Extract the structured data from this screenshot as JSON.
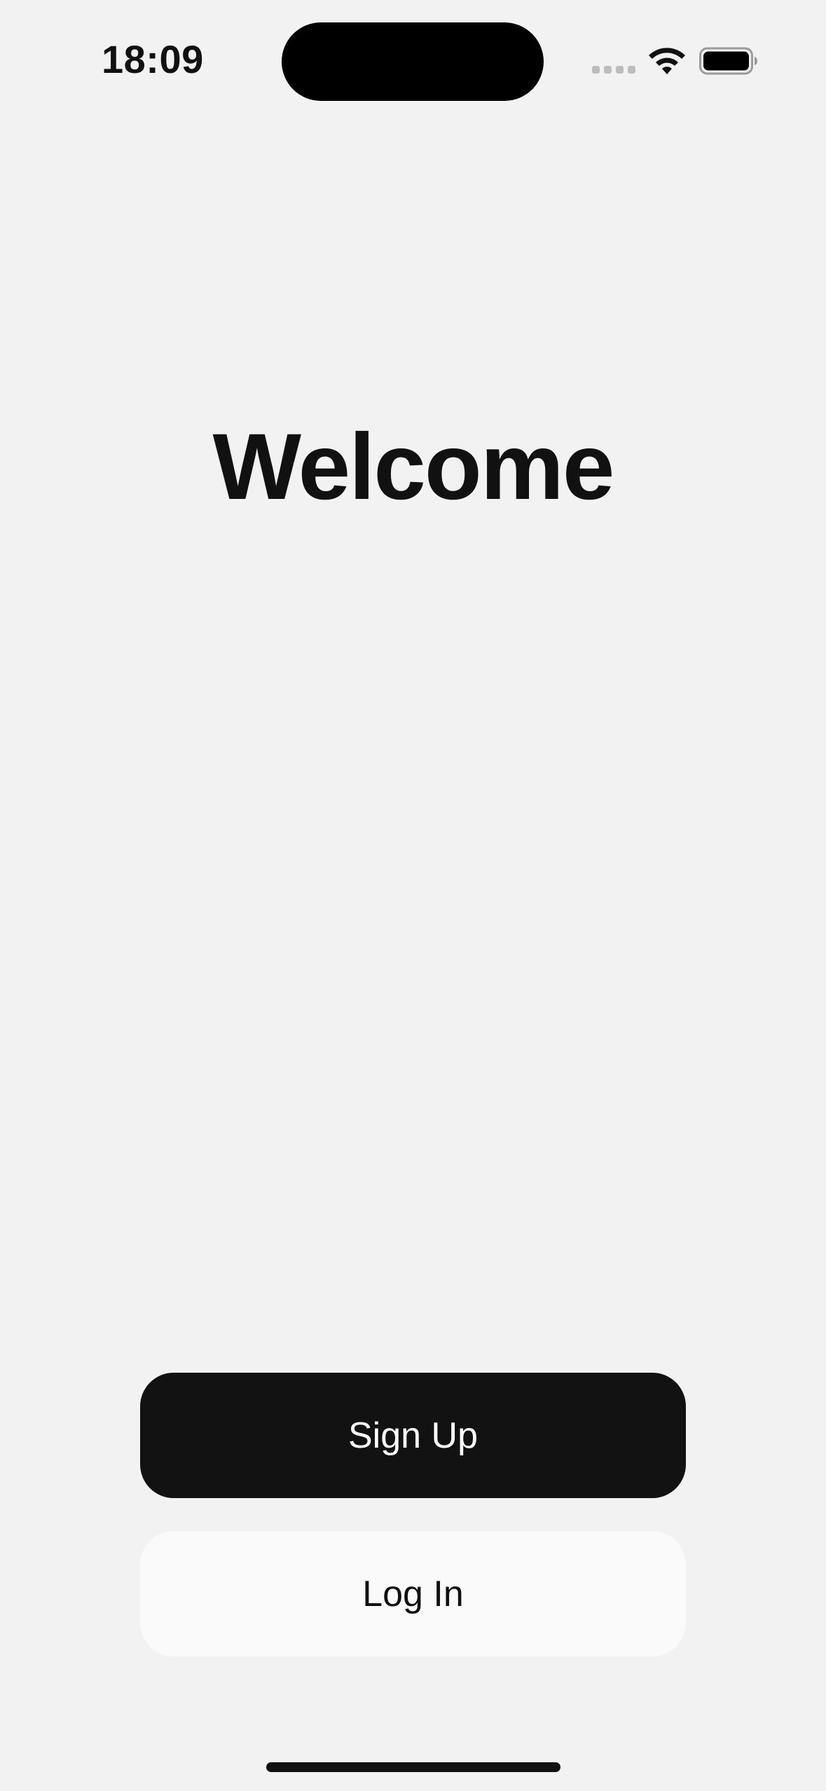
{
  "status_bar": {
    "time": "18:09",
    "icons": [
      "signal-dots-icon",
      "wifi-icon",
      "battery-icon"
    ]
  },
  "main": {
    "title": "Welcome"
  },
  "actions": {
    "signup_label": "Sign Up",
    "login_label": "Log In"
  },
  "colors": {
    "background": "#f2f2f2",
    "primary_button": "#121212",
    "secondary_button": "#fafafa",
    "text": "#111111"
  }
}
